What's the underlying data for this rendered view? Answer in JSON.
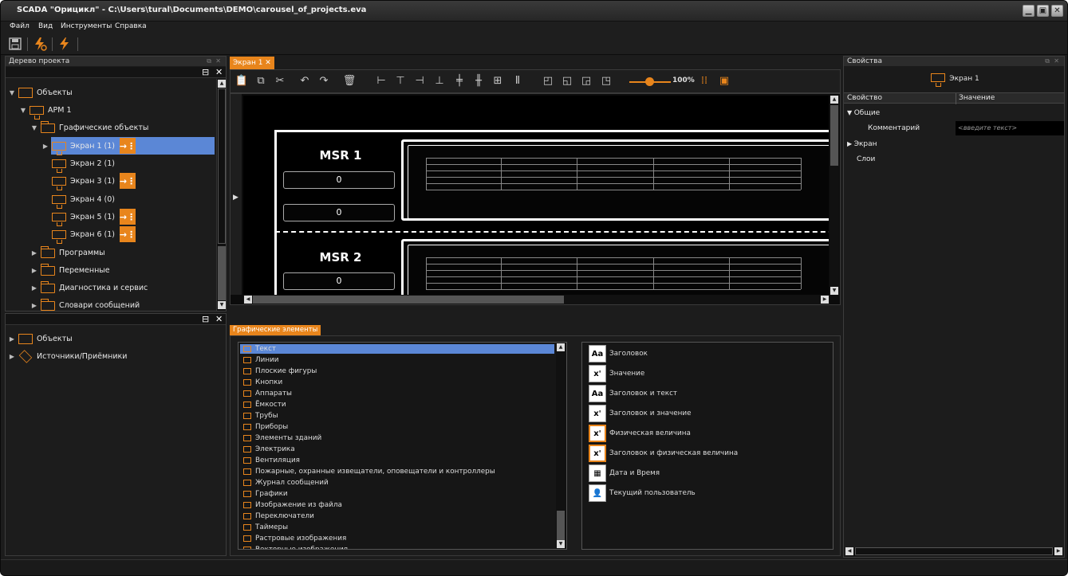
{
  "window": {
    "title": "SCADA \"Орицикл\" - C:\\Users\\tural\\Documents\\DEMO\\carousel_of_projects.eva"
  },
  "menu": [
    "Файл",
    "Вид",
    "Инструменты",
    "Справка"
  ],
  "project_tree": {
    "title": "Дерево проекта",
    "items": [
      {
        "label": "Объекты"
      },
      {
        "label": "АРМ 1"
      },
      {
        "label": "Графические объекты"
      },
      {
        "label": "Экран 1 (1)"
      },
      {
        "label": "Экран 2 (1)"
      },
      {
        "label": "Экран 3 (1)"
      },
      {
        "label": "Экран 4 (0)"
      },
      {
        "label": "Экран 5 (1)"
      },
      {
        "label": "Экран 6 (1)"
      },
      {
        "label": "Программы"
      },
      {
        "label": "Переменные"
      },
      {
        "label": "Диагностика и сервис"
      },
      {
        "label": "Словари сообщений"
      }
    ]
  },
  "objects_tree": {
    "items": [
      {
        "label": "Объекты"
      },
      {
        "label": "Источники/Приёмники"
      }
    ]
  },
  "editor": {
    "tab_label": "Экран 1",
    "zoom": "100%",
    "canvas": {
      "msr1": {
        "title": "MSR 1",
        "value1": "0",
        "value2": "0"
      },
      "msr2": {
        "title": "MSR 2",
        "value1": "0"
      }
    }
  },
  "graphic_elements": {
    "tab_label": "Графические элементы",
    "categories": [
      "Текст",
      "Линии",
      "Плоские фигуры",
      "Кнопки",
      "Аппараты",
      "Ёмкости",
      "Трубы",
      "Приборы",
      "Элементы зданий",
      "Электрика",
      "Вентиляция",
      "Пожарные, охранные извещатели, оповещатели и контроллеры",
      "Журнал сообщений",
      "Графики",
      "Изображение из файла",
      "Переключатели",
      "Таймеры",
      "Растровые изображения",
      "Векторные изображения"
    ],
    "elements": [
      {
        "label": "Заголовок",
        "icon": "Aa"
      },
      {
        "label": "Значение",
        "icon": "x'"
      },
      {
        "label": "Заголовок и текст",
        "icon": "Aa"
      },
      {
        "label": "Заголовок и значение",
        "icon": "x'"
      },
      {
        "label": "Физическая величина",
        "icon": "x'"
      },
      {
        "label": "Заголовок и физическая величина",
        "icon": "x'"
      },
      {
        "label": "Дата и Время",
        "icon": "calendar-icon"
      },
      {
        "label": "Текущий пользователь",
        "icon": "user-icon"
      }
    ]
  },
  "properties": {
    "title": "Свойства",
    "object_name": "Экран 1",
    "col_property": "Свойство",
    "col_value": "Значение",
    "group_general": "Общие",
    "comment_label": "Комментарий",
    "comment_placeholder": "<введите текст>",
    "group_screen": "Экран",
    "layers": "Слои"
  },
  "colors": {
    "accent": "#e8851c",
    "selection": "#5b87d6",
    "background": "#1c1c1c"
  }
}
